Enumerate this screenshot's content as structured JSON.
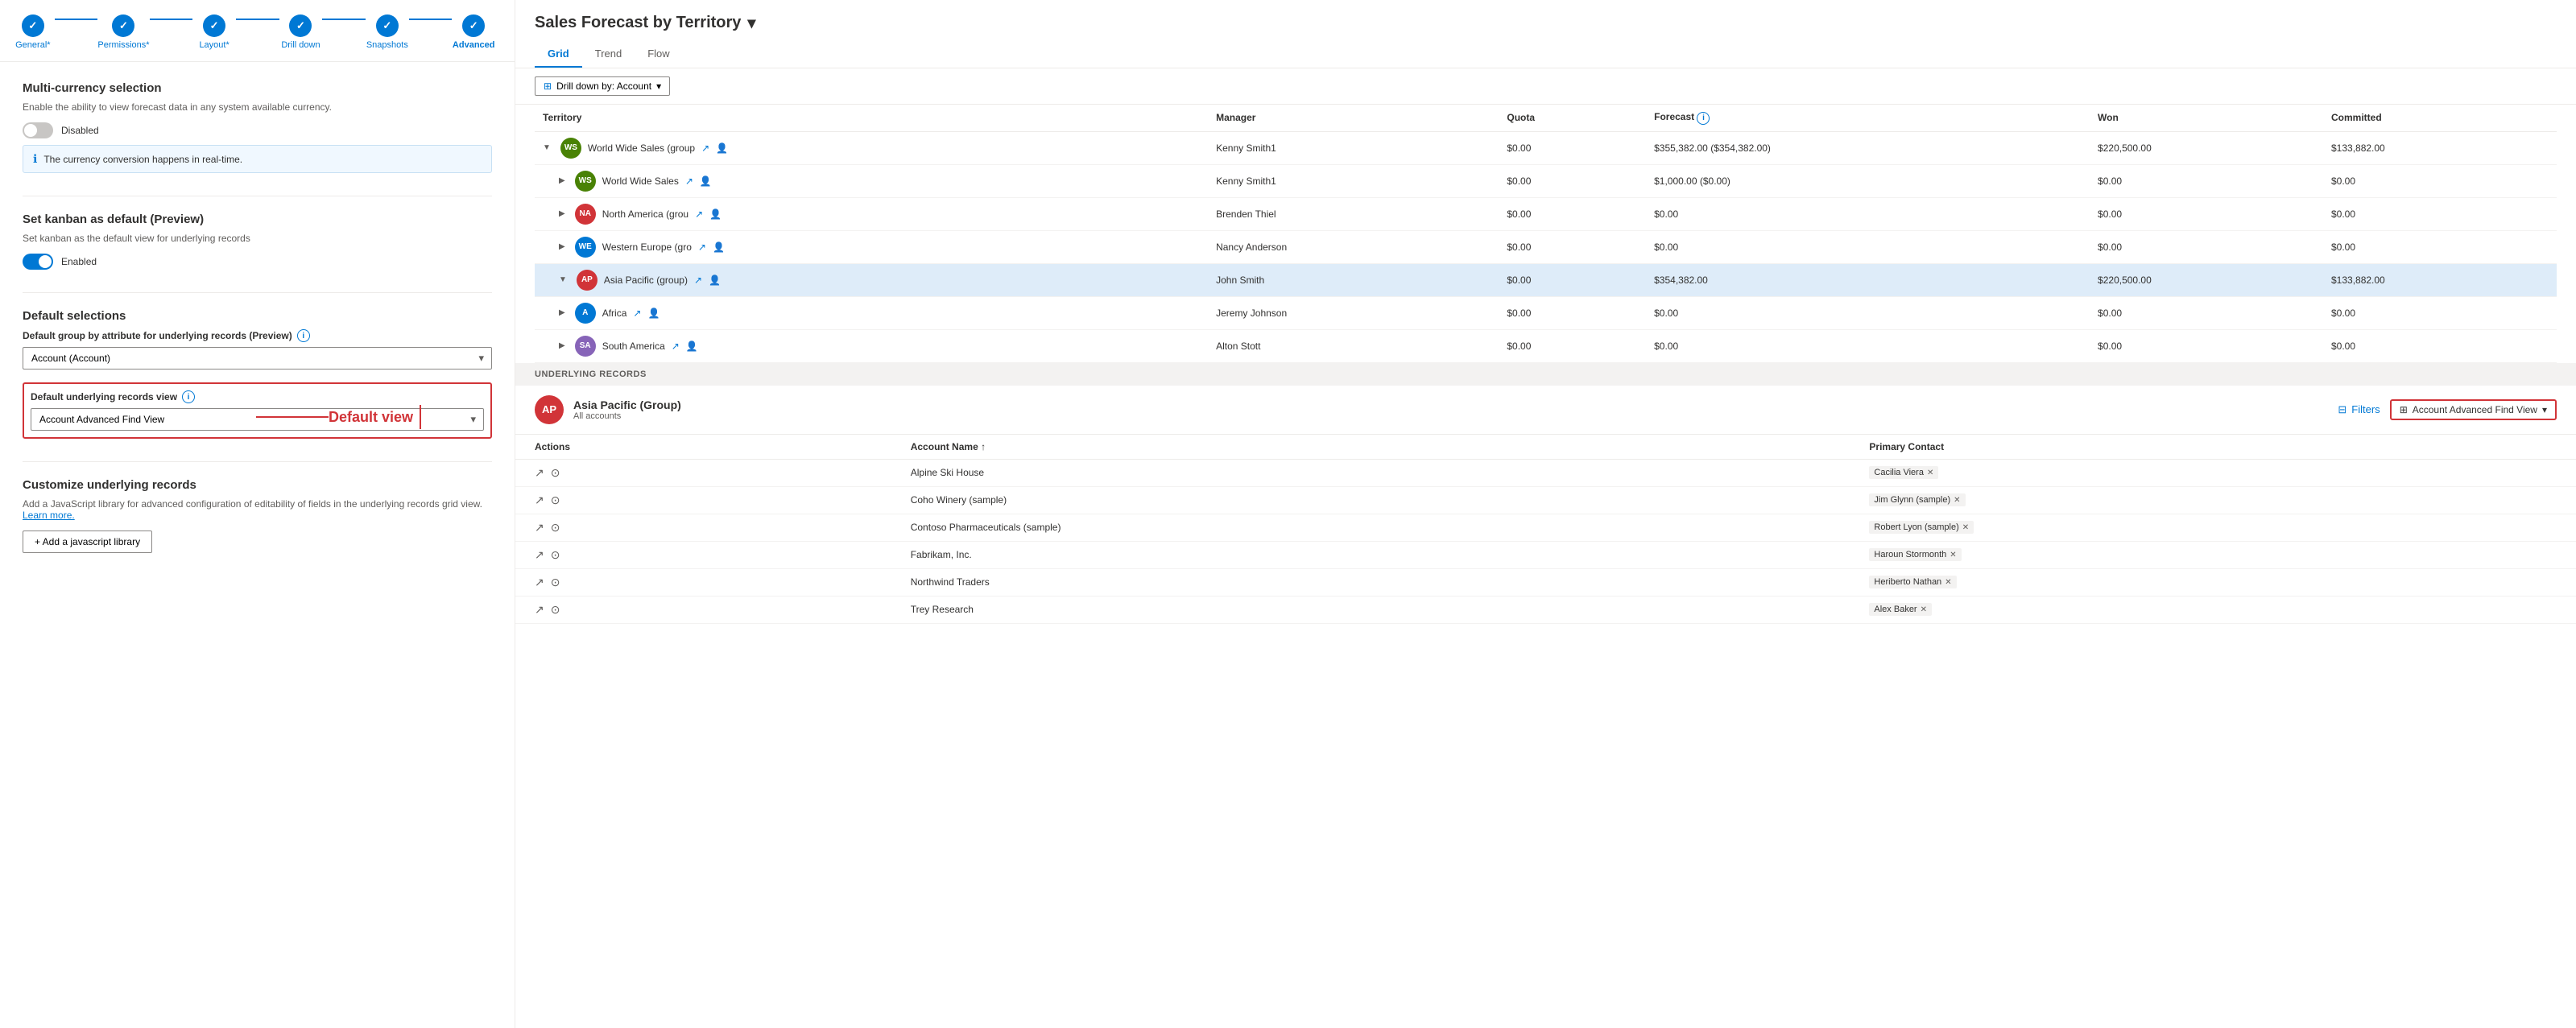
{
  "stepper": {
    "steps": [
      {
        "id": "general",
        "label": "General*",
        "active": false,
        "completed": true
      },
      {
        "id": "permissions",
        "label": "Permissions*",
        "active": false,
        "completed": true
      },
      {
        "id": "layout",
        "label": "Layout*",
        "active": false,
        "completed": true
      },
      {
        "id": "drilldown",
        "label": "Drill down",
        "active": false,
        "completed": true
      },
      {
        "id": "snapshots",
        "label": "Snapshots",
        "active": false,
        "completed": true
      },
      {
        "id": "advanced",
        "label": "Advanced",
        "active": true,
        "completed": true
      }
    ]
  },
  "left": {
    "multicurrency": {
      "title": "Multi-currency selection",
      "desc": "Enable the ability to view forecast data in any system available currency.",
      "toggle_state": "Disabled",
      "info_text": "The currency conversion happens in real-time."
    },
    "kanban": {
      "title": "Set kanban as default (Preview)",
      "desc": "Set kanban as the default view for underlying records",
      "toggle_state": "Enabled"
    },
    "default_selections": {
      "title": "Default selections",
      "group_label": "Default group by attribute for underlying records (Preview)",
      "group_value": "Account (Account)",
      "view_label": "Default underlying records view",
      "view_value": "Account Advanced Find View",
      "annotation": "Default view"
    },
    "customize": {
      "title": "Customize underlying records",
      "desc": "Add a JavaScript library for advanced configuration of editability of fields in the underlying records grid view.",
      "learn_more": "Learn more.",
      "add_btn": "+ Add a javascript library"
    }
  },
  "forecast": {
    "title": "Sales Forecast by Territory",
    "tabs": [
      "Grid",
      "Trend",
      "Flow"
    ],
    "active_tab": "Grid",
    "drill_btn": "Drill down by: Account",
    "columns": [
      "Territory",
      "Manager",
      "Quota",
      "Forecast",
      "Won",
      "Committed"
    ],
    "rows": [
      {
        "indent": 0,
        "expanded": true,
        "avatar_text": "WS",
        "avatar_color": "#498205",
        "name": "World Wide Sales (group",
        "manager": "Kenny Smith1",
        "quota": "$0.00",
        "forecast": "$355,382.00 ($354,382.00)",
        "won": "$220,500.00",
        "committed": "$133,882.00",
        "highlighted": false
      },
      {
        "indent": 1,
        "expanded": false,
        "avatar_text": "WS",
        "avatar_color": "#498205",
        "name": "World Wide Sales",
        "manager": "Kenny Smith1",
        "quota": "$0.00",
        "forecast": "$1,000.00 ($0.00)",
        "won": "$0.00",
        "committed": "$0.00",
        "highlighted": false
      },
      {
        "indent": 1,
        "expanded": false,
        "avatar_text": "NA",
        "avatar_color": "#d13438",
        "name": "North America (grou",
        "manager": "Brenden Thiel",
        "quota": "$0.00",
        "forecast": "$0.00",
        "won": "$0.00",
        "committed": "$0.00",
        "highlighted": false
      },
      {
        "indent": 1,
        "expanded": false,
        "avatar_text": "WE",
        "avatar_color": "#0078d4",
        "name": "Western Europe (gro",
        "manager": "Nancy Anderson",
        "quota": "$0.00",
        "forecast": "$0.00",
        "won": "$0.00",
        "committed": "$0.00",
        "highlighted": false
      },
      {
        "indent": 1,
        "expanded": true,
        "avatar_text": "AP",
        "avatar_color": "#d13438",
        "name": "Asia Pacific (group)",
        "manager": "John Smith",
        "quota": "$0.00",
        "forecast": "$354,382.00",
        "won": "$220,500.00",
        "committed": "$133,882.00",
        "highlighted": true
      },
      {
        "indent": 1,
        "expanded": false,
        "avatar_text": "A",
        "avatar_color": "#0078d4",
        "name": "Africa",
        "manager": "Jeremy Johnson",
        "quota": "$0.00",
        "forecast": "$0.00",
        "won": "$0.00",
        "committed": "$0.00",
        "highlighted": false
      },
      {
        "indent": 1,
        "expanded": false,
        "avatar_text": "SA",
        "avatar_color": "#8764b8",
        "name": "South America",
        "manager": "Alton Stott",
        "quota": "$0.00",
        "forecast": "$0.00",
        "won": "$0.00",
        "committed": "$0.00",
        "highlighted": false
      }
    ]
  },
  "underlying": {
    "section_label": "UNDERLYING RECORDS",
    "group_name": "Asia Pacific (Group)",
    "group_sub": "All accounts",
    "group_avatar": "AP",
    "filter_btn": "Filters",
    "view_name": "Account Advanced Find View",
    "columns": [
      "Actions",
      "Account Name",
      "Primary Contact"
    ],
    "rows": [
      {
        "name": "Alpine Ski House",
        "contact": "Cacilia Viera"
      },
      {
        "name": "Coho Winery (sample)",
        "contact": "Jim Glynn (sample)"
      },
      {
        "name": "Contoso Pharmaceuticals (sample)",
        "contact": "Robert Lyon (sample)"
      },
      {
        "name": "Fabrikam, Inc.",
        "contact": "Haroun Stormonth"
      },
      {
        "name": "Northwind Traders",
        "contact": "Heriberto Nathan"
      },
      {
        "name": "Trey Research",
        "contact": "Alex Baker"
      }
    ]
  }
}
